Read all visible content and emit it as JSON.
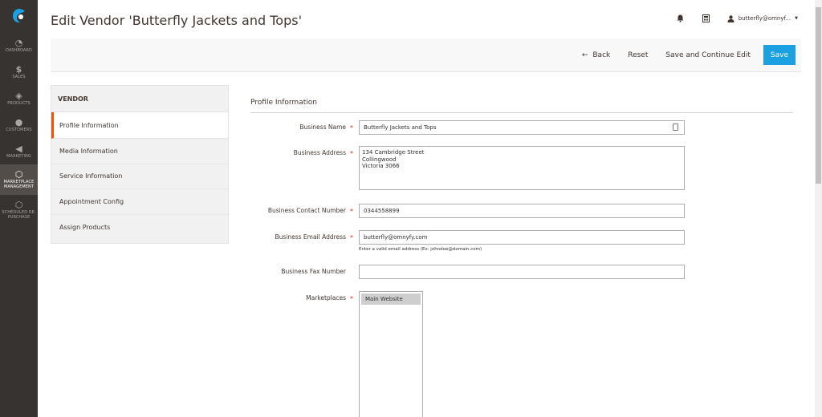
{
  "nav": {
    "items": [
      {
        "label": "DASHBOARD",
        "icon": "dashboard-icon"
      },
      {
        "label": "SALES",
        "icon": "dollar-icon"
      },
      {
        "label": "PRODUCTS",
        "icon": "cube-icon"
      },
      {
        "label": "CUSTOMERS",
        "icon": "person-icon"
      },
      {
        "label": "MARKETING",
        "icon": "megaphone-icon"
      },
      {
        "label": "MARKETPLACE MANAGEMENT",
        "icon": "hexagon-icon"
      },
      {
        "label": "SCHEDULED RE-PURCHASE",
        "icon": "hexagon-outline-icon"
      }
    ]
  },
  "header": {
    "title": "Edit Vendor 'Butterfly Jackets and Tops'",
    "user": "butterfly@omnyf..."
  },
  "actions": {
    "back": "Back",
    "reset": "Reset",
    "save_continue": "Save and Continue Edit",
    "save": "Save"
  },
  "tabs": {
    "title": "VENDOR",
    "items": [
      "Profile Information",
      "Media Information",
      "Service Information",
      "Appointment Config",
      "Assign Products"
    ]
  },
  "form": {
    "section_title": "Profile Information",
    "business_name": {
      "label": "Business Name",
      "value": "Butterfly Jackets and Tops"
    },
    "business_address": {
      "label": "Business Address",
      "value": "134 Cambridge Street\nCollingwood\nVictoria 3066"
    },
    "contact_number": {
      "label": "Business Contact Number",
      "value": "0344558899"
    },
    "email": {
      "label": "Business Email Address",
      "value": "butterfly@omnyfy.com",
      "note": "Enter a valid email address (Ex: johndoe@domain.com)"
    },
    "fax": {
      "label": "Business Fax Number",
      "value": ""
    },
    "marketplaces": {
      "label": "Marketplaces",
      "options": [
        "Main Website"
      ]
    }
  },
  "required_mark": "*",
  "colors": {
    "accent": "#eb5202",
    "primary_button": "#1ba1e2",
    "nav_bg": "#373330"
  }
}
